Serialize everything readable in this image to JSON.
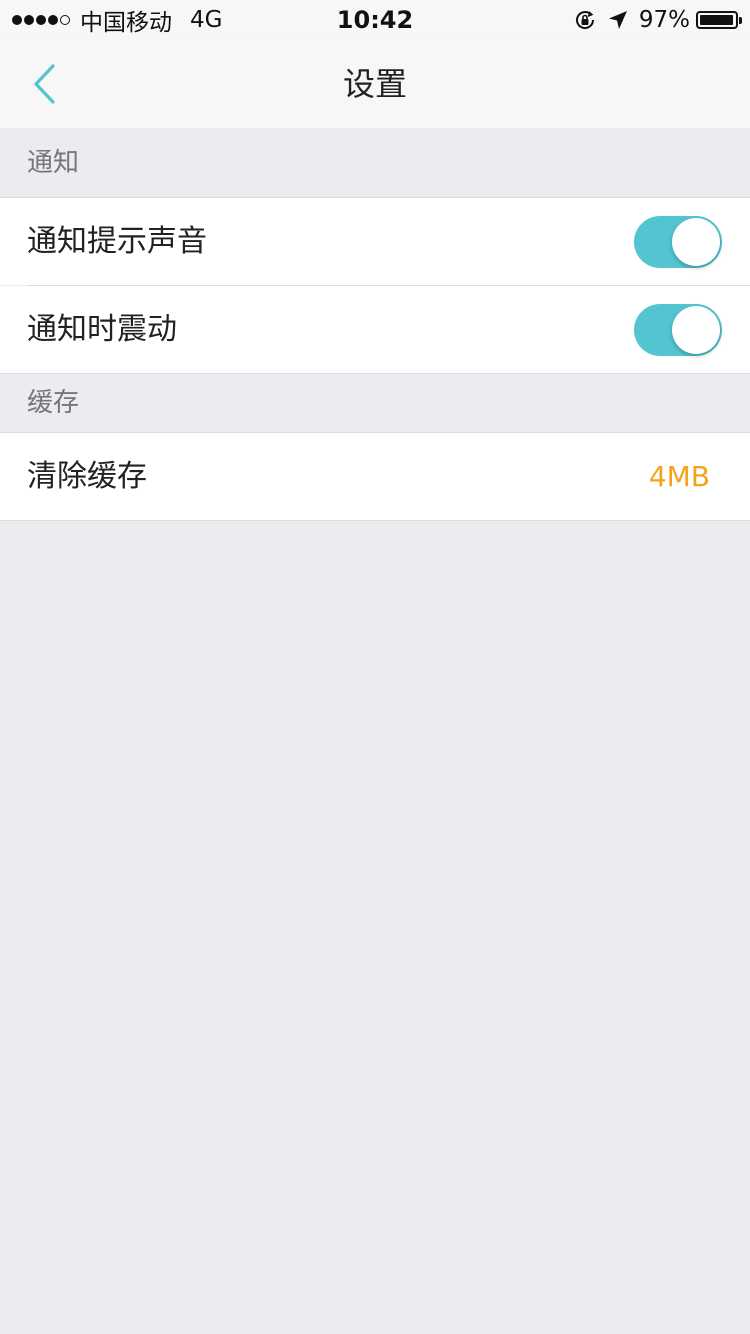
{
  "status_bar": {
    "signal_filled": 4,
    "signal_total": 5,
    "carrier": "中国移动",
    "network": "4G",
    "time": "10:42",
    "battery_percent": "97%",
    "battery_level": 0.97,
    "icons": [
      "orientation-lock-icon",
      "location-arrow-icon",
      "battery-icon"
    ]
  },
  "nav": {
    "title": "设置",
    "back_icon": "chevron-left-icon",
    "accent_color": "#52c5d0"
  },
  "sections": [
    {
      "header": "通知",
      "rows": [
        {
          "label": "通知提示声音",
          "toggle_on": true
        },
        {
          "label": "通知时震动",
          "toggle_on": true
        }
      ]
    },
    {
      "header": "缓存",
      "rows": [
        {
          "label": "清除缓存",
          "value": "4MB",
          "value_color": "#f5a31a"
        }
      ]
    }
  ]
}
